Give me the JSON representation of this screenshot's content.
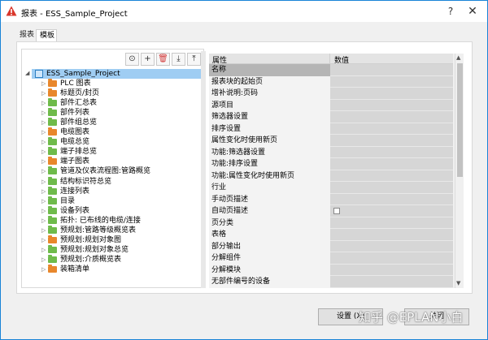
{
  "window": {
    "title": "报表 - ESS_Sample_Project",
    "help_glyph": "?",
    "close_glyph": "✕"
  },
  "tabs": [
    {
      "label": "报表",
      "active": false
    },
    {
      "label": "模板",
      "active": true
    }
  ],
  "toolbar": {
    "buttons": [
      {
        "icon": "play-icon",
        "glyph": "⊙"
      },
      {
        "icon": "add-icon",
        "glyph": "+"
      },
      {
        "icon": "delete-icon",
        "glyph": "🗑"
      },
      {
        "icon": "import-icon",
        "glyph": "⤓"
      },
      {
        "icon": "export-icon",
        "glyph": "⤒"
      }
    ]
  },
  "tree": {
    "root": {
      "label": "ESS_Sample_Project",
      "expanded": true
    },
    "items": [
      {
        "label": "PLC 图表",
        "color": "orange"
      },
      {
        "label": "标题页/封页",
        "color": "orange"
      },
      {
        "label": "部件汇总表",
        "color": "green"
      },
      {
        "label": "部件列表",
        "color": "green"
      },
      {
        "label": "部件组总览",
        "color": "green"
      },
      {
        "label": "电缆图表",
        "color": "orange"
      },
      {
        "label": "电缆总览",
        "color": "green"
      },
      {
        "label": "端子排总览",
        "color": "green"
      },
      {
        "label": "端子图表",
        "color": "orange"
      },
      {
        "label": "管道及仪表流程图:管路概览",
        "color": "green"
      },
      {
        "label": "结构标识符总览",
        "color": "green"
      },
      {
        "label": "连接列表",
        "color": "green"
      },
      {
        "label": "目录",
        "color": "green"
      },
      {
        "label": "设备列表",
        "color": "green"
      },
      {
        "label": "拓扑: 已布线的电缆/连接",
        "color": "green"
      },
      {
        "label": "预规划:管路等级概览表",
        "color": "green"
      },
      {
        "label": "预规划:规划对象图",
        "color": "orange"
      },
      {
        "label": "预规划:规划对象总览",
        "color": "green"
      },
      {
        "label": "预规划:介质概览表",
        "color": "green"
      },
      {
        "label": "装箱清单",
        "color": "orange"
      }
    ]
  },
  "properties": {
    "col_property": "属性",
    "col_value": "数值",
    "rows": [
      {
        "name": "名称",
        "value": "",
        "selected": true
      },
      {
        "name": "报表块的起始页",
        "value": ""
      },
      {
        "name": "增补说明:页码",
        "value": ""
      },
      {
        "name": "源项目",
        "value": ""
      },
      {
        "name": "筛选器设置",
        "value": ""
      },
      {
        "name": "排序设置",
        "value": ""
      },
      {
        "name": "属性变化时使用新页",
        "value": ""
      },
      {
        "name": "功能:筛选器设置",
        "value": ""
      },
      {
        "name": "功能:排序设置",
        "value": ""
      },
      {
        "name": "功能:属性变化时使用新页",
        "value": ""
      },
      {
        "name": "行业",
        "value": ""
      },
      {
        "name": "手动页描述",
        "value": ""
      },
      {
        "name": "自动页描述",
        "value": "",
        "checkbox": true
      },
      {
        "name": "页分类",
        "value": ""
      },
      {
        "name": "表格",
        "value": ""
      },
      {
        "name": "部分输出",
        "value": ""
      },
      {
        "name": "分解组件",
        "value": ""
      },
      {
        "name": "分解模块",
        "value": ""
      },
      {
        "name": "无部件编号的设备",
        "value": ""
      }
    ]
  },
  "buttons": {
    "settings": "设置 (X)",
    "close": "关闭"
  },
  "watermark": "知乎 @EPLAN小白"
}
